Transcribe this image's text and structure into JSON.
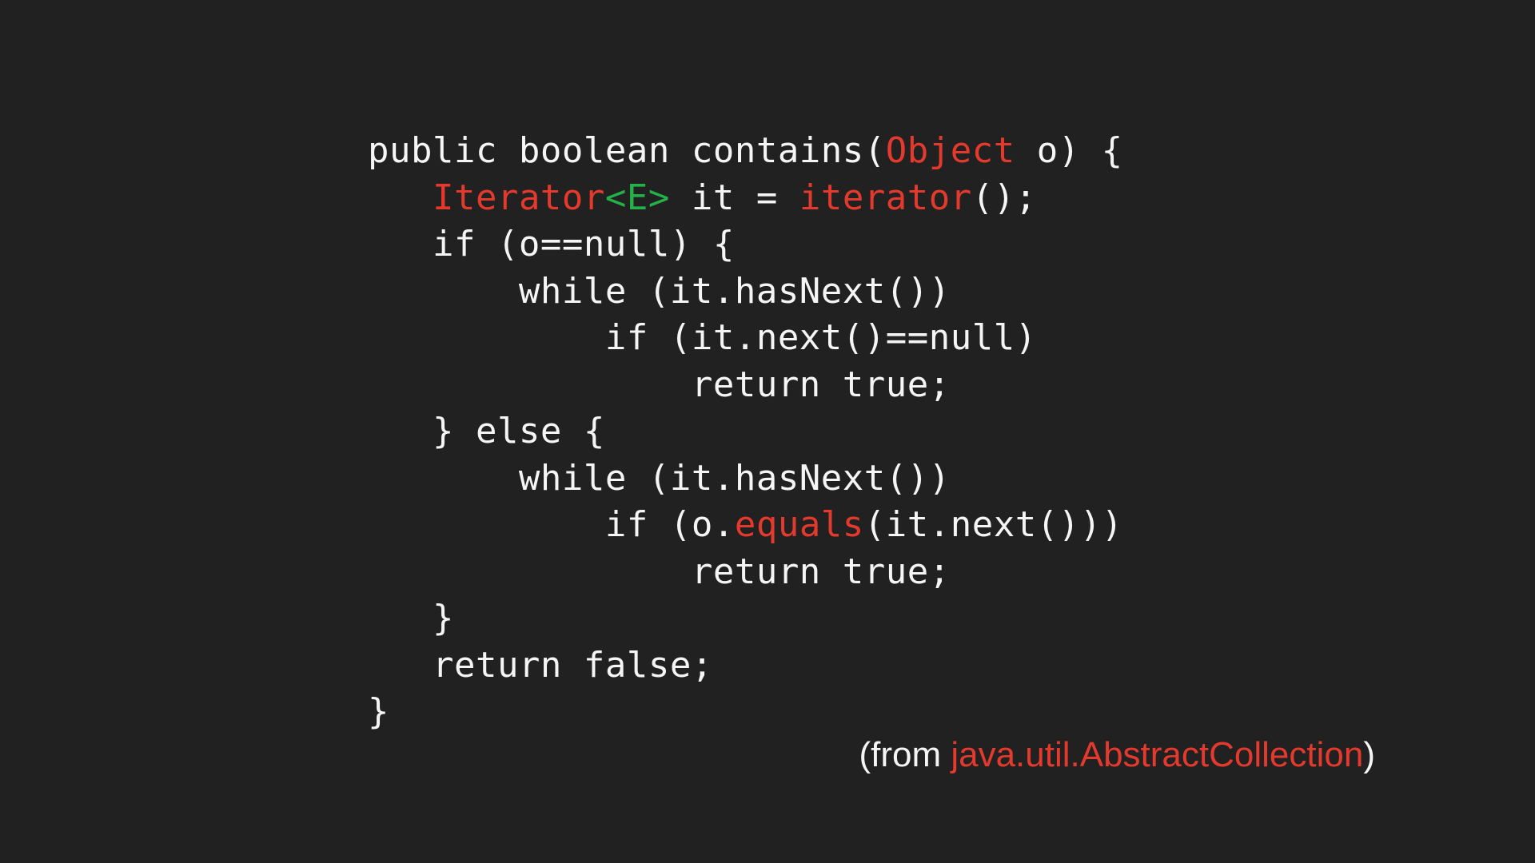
{
  "code": {
    "l1a": "public boolean contains(",
    "l1b": "Object",
    "l1c": " o) {",
    "l2_indent": "   ",
    "l2a": "Iterator",
    "l2b": "<E>",
    "l2c": " it = ",
    "l2d": "iterator",
    "l2e": "();",
    "l3": "   if (o==null) {",
    "l4": "       while (it.hasNext())",
    "l5": "           if (it.next()==null)",
    "l6": "               return true;",
    "l7": "   } else {",
    "l8": "       while (it.hasNext())",
    "l9a": "           if (o.",
    "l9b": "equals",
    "l9c": "(it.next()))",
    "l10": "               return true;",
    "l11": "   }",
    "l12": "   return false;",
    "l13": "}"
  },
  "attribution": {
    "prefix": "(from ",
    "class": "java.util.AbstractCollection",
    "suffix": ")"
  }
}
